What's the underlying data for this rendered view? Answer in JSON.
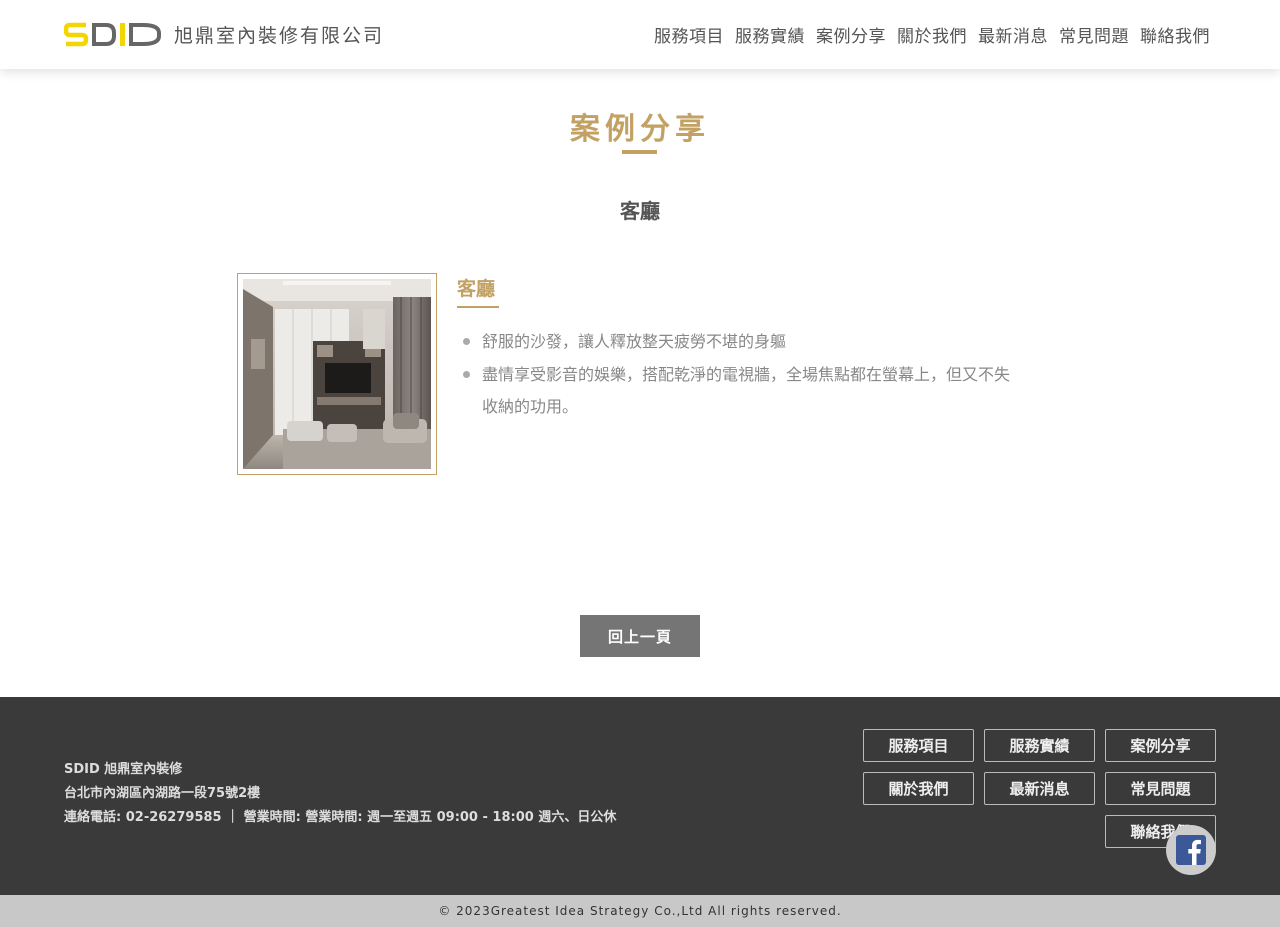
{
  "header": {
    "logo_mark": "SDID",
    "logo_text": "旭鼎室內裝修有限公司",
    "nav": [
      "服務項目",
      "服務實績",
      "案例分享",
      "關於我們",
      "最新消息",
      "常見問題",
      "聯絡我們"
    ]
  },
  "main": {
    "section_title": "案例分享",
    "category_title": "客廳",
    "item": {
      "title": "客廳",
      "photo_alt": "客廳",
      "features": [
        "舒服的沙發，讓人釋放整天疲勞不堪的身軀",
        "盡情享受影音的娛樂，搭配乾淨的電視牆，全場焦點都在螢幕上，但又不失收納的功用。"
      ]
    },
    "back_button": "回上一頁"
  },
  "footer": {
    "company": "SDID 旭鼎室內裝修",
    "address": "台北市內湖區內湖路一段75號2樓",
    "contact": "連絡電話: 02-26279585 ｜ 營業時間: 營業時間: 週一至週五 09:00 - 18:00 週六、日公休",
    "nav": [
      "服務項目",
      "服務實績",
      "案例分享",
      "關於我們",
      "最新消息",
      "常見問題",
      "聯絡我們"
    ],
    "facebook_icon": "facebook-icon"
  },
  "copyright": "© 2023Greatest Idea Strategy Co.,Ltd All rights reserved.",
  "colors": {
    "accent_gold": "#c2a163",
    "logo_yellow": "#f2d600",
    "footer_bg": "#3a3a3a",
    "button_gray": "#757575"
  }
}
